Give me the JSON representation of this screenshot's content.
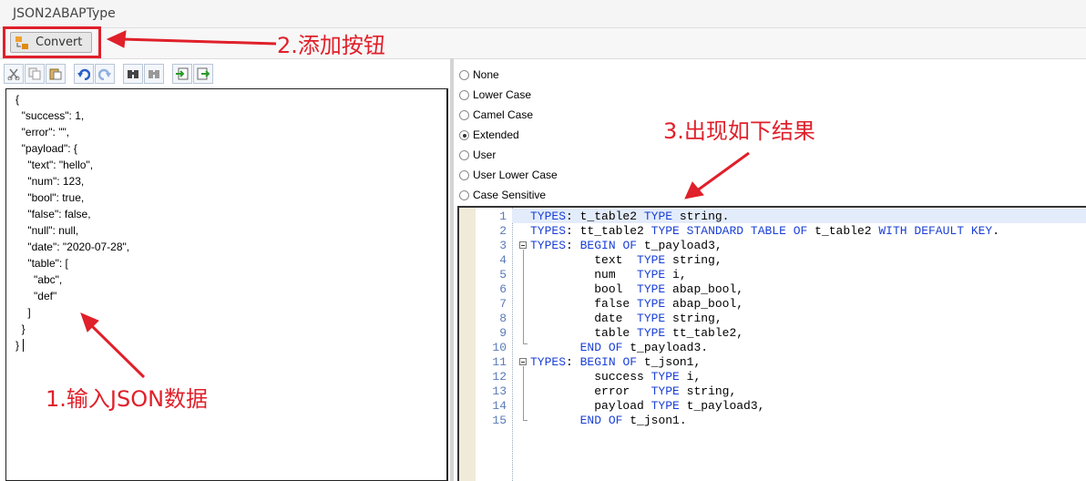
{
  "window": {
    "title": "JSON2ABAPType"
  },
  "appbar": {
    "convert_label": "Convert"
  },
  "annotations": {
    "step1": "1.输入JSON数据",
    "step2": "2.添加按钮",
    "step3": "3.出现如下结果"
  },
  "colors": {
    "annotation": "#e0202a",
    "keyword": "#1a3fd6",
    "line_number": "#5a7ab8"
  },
  "toolbar": {
    "icons": [
      "cut-icon",
      "copy-icon",
      "paste-icon",
      "undo-icon",
      "redo-icon",
      "find-icon",
      "replace-icon",
      "import-icon",
      "export-icon"
    ]
  },
  "json_input": {
    "lines": [
      "{",
      "  \"success\": 1,",
      "  \"error\": \"\",",
      "  \"payload\": {",
      "    \"text\": \"hello\",",
      "    \"num\": 123,",
      "    \"bool\": true,",
      "    \"false\": false,",
      "    \"null\": null,",
      "    \"date\": \"2020-07-28\",",
      "    \"table\": [",
      "      \"abc\",",
      "      \"def\"",
      "    ]",
      "  }",
      "}"
    ]
  },
  "case_options": {
    "selected": "Extended",
    "items": [
      "None",
      "Lower Case",
      "Camel Case",
      "Extended",
      "User",
      "User Lower Case",
      "Case Sensitive"
    ]
  },
  "abap_output": {
    "lines": [
      "TYPES: t_table2 TYPE string.",
      "TYPES: tt_table2 TYPE STANDARD TABLE OF t_table2 WITH DEFAULT KEY.",
      "TYPES: BEGIN OF t_payload3,",
      "         text  TYPE string,",
      "         num   TYPE i,",
      "         bool  TYPE abap_bool,",
      "         false TYPE abap_bool,",
      "         date  TYPE string,",
      "         table TYPE tt_table2,",
      "       END OF t_payload3.",
      "TYPES: BEGIN OF t_json1,",
      "         success TYPE i,",
      "         error   TYPE string,",
      "         payload TYPE t_payload3,",
      "       END OF t_json1."
    ],
    "line_numbers": [
      "1",
      "2",
      "3",
      "4",
      "5",
      "6",
      "7",
      "8",
      "9",
      "10",
      "11",
      "12",
      "13",
      "14",
      "15"
    ]
  }
}
